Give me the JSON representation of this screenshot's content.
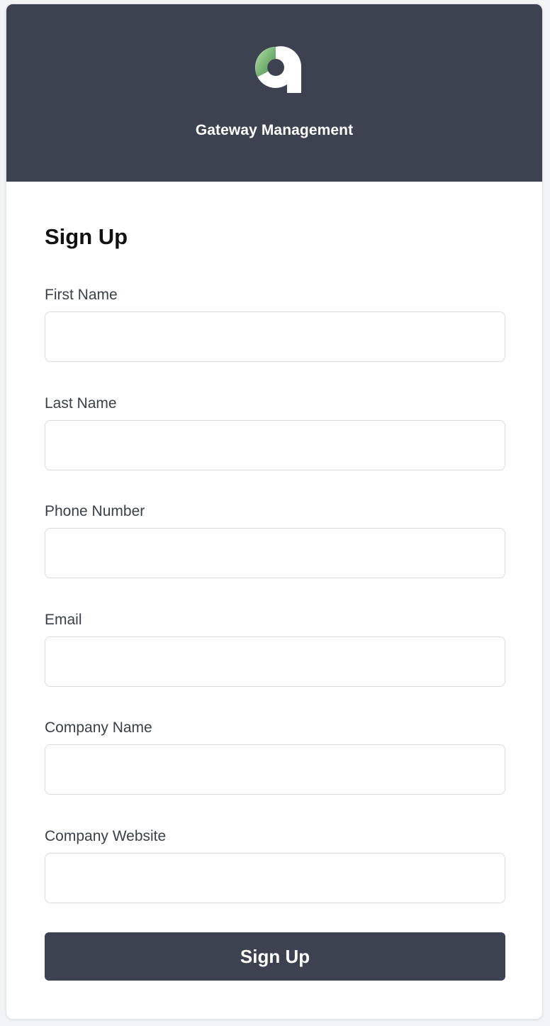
{
  "header": {
    "logo_icon": "gateway-logo-icon",
    "app_title": "Gateway Management",
    "background_color": "#3c424f",
    "logo_colors": {
      "white": "#ffffff",
      "green_light": "#a9d6a2",
      "green_dark": "#3f8c3f"
    }
  },
  "form": {
    "title": "Sign Up",
    "fields": [
      {
        "label": "First Name",
        "value": "",
        "placeholder": ""
      },
      {
        "label": "Last Name",
        "value": "",
        "placeholder": ""
      },
      {
        "label": "Phone Number",
        "value": "",
        "placeholder": ""
      },
      {
        "label": "Email",
        "value": "",
        "placeholder": ""
      },
      {
        "label": "Company Name",
        "value": "",
        "placeholder": ""
      },
      {
        "label": "Company Website",
        "value": "",
        "placeholder": ""
      }
    ],
    "submit_label": "Sign Up",
    "submit_color": "#3c424f"
  }
}
